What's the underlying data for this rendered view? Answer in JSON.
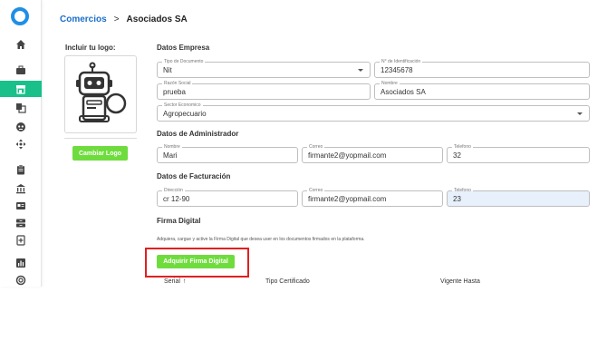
{
  "app": {
    "accent_color": "#1f8fe6",
    "active_color": "#19c08a",
    "button_color": "#6fdc3e",
    "highlight_color": "#e02020"
  },
  "sidebar": {
    "items": [
      {
        "icon": "home-icon"
      },
      {
        "icon": "briefcase-icon"
      },
      {
        "icon": "store-icon",
        "active": true
      },
      {
        "icon": "copy-icon"
      },
      {
        "icon": "robot-icon"
      },
      {
        "icon": "move-icon"
      },
      {
        "icon": "clipboard-icon"
      },
      {
        "icon": "bank-icon"
      },
      {
        "icon": "id-card-icon"
      },
      {
        "icon": "inbox-icon"
      },
      {
        "icon": "file-plus-icon"
      },
      {
        "icon": "chart-icon"
      },
      {
        "icon": "lifebuoy-icon"
      }
    ]
  },
  "breadcrumb": {
    "parent": "Comercios",
    "separator": ">",
    "current": "Asociados SA"
  },
  "logo_section": {
    "title": "Incluir tu logo:",
    "button_label": "Cambiar Logo"
  },
  "datos_empresa": {
    "title": "Datos Empresa",
    "tipo_documento": {
      "label": "Tipo de Documento",
      "value": "Nit"
    },
    "identificacion": {
      "label": "N° de Identificación",
      "value": "12345678"
    },
    "razon_social": {
      "label": "Razón Social",
      "value": "prueba"
    },
    "nombre": {
      "label": "Nombre",
      "value": "Asociados SA"
    },
    "sector": {
      "label": "Sector Economico",
      "value": "Agropecuario"
    }
  },
  "datos_admin": {
    "title": "Datos de Administrador",
    "nombre": {
      "label": "Nombre",
      "value": "Mari"
    },
    "correo": {
      "label": "Correo",
      "value": "firmante2@yopmail.com"
    },
    "telefono": {
      "label": "Telefono",
      "value": "32"
    }
  },
  "datos_facturacion": {
    "title": "Datos de Facturación",
    "direccion": {
      "label": "Dirección",
      "value": "cr 12-90"
    },
    "correo": {
      "label": "Correo",
      "value": "firmante2@yopmail.com"
    },
    "telefono": {
      "label": "Telefono",
      "value": "23"
    }
  },
  "firma_digital": {
    "title": "Firma Digital",
    "description": "Adquiera, cargue y active la Firma Digital que desea user en los documentos firmados en la plataforma.",
    "button_label": "Adquirir Firma Digital"
  },
  "table": {
    "columns": [
      "Serial",
      "Tipo Certificado",
      "Vigente Hasta"
    ],
    "sort_indicator": "↑"
  }
}
